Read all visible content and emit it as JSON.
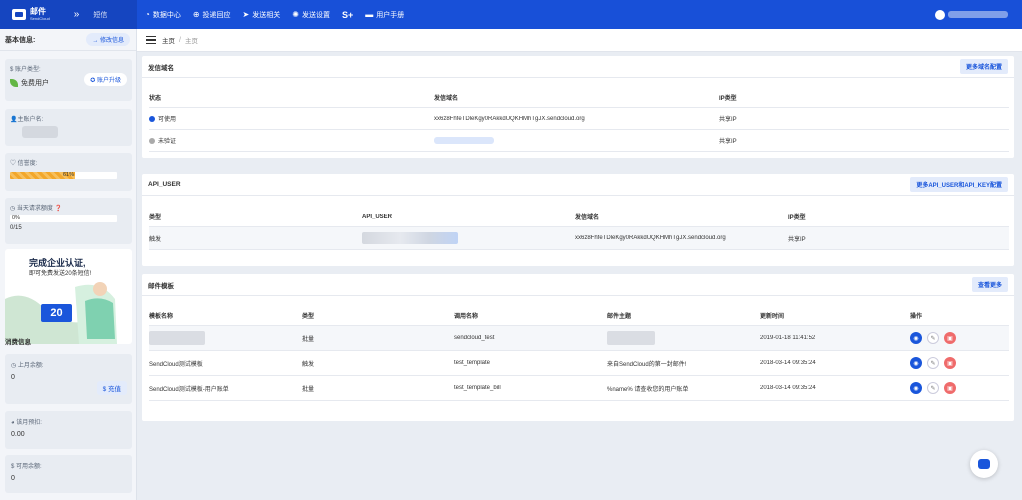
{
  "topbar": {
    "brand_name": "邮件",
    "brand_sub": "SendCloud",
    "collapse_glyph": "»",
    "sms_label": "短信",
    "nav": [
      {
        "icon": "chart-icon",
        "label": "数据中心"
      },
      {
        "icon": "delivery-icon",
        "label": "投递回应"
      },
      {
        "icon": "send-icon",
        "label": "发送相关"
      },
      {
        "icon": "settings-icon",
        "label": "发送设置"
      },
      {
        "icon": "s-plus-icon",
        "label": "S+"
      },
      {
        "icon": "folder-icon",
        "label": "用户手册"
      }
    ]
  },
  "sidebar": {
    "title": "基本信息:",
    "edit_btn": "→ 修改信息",
    "account_type_label": "$ 账户类型:",
    "account_type_value": "免费用户",
    "upgrade_btn": "✪ 账户升级",
    "account_name_label": "主账户名:",
    "credit_label": "信誉度:",
    "credit_value": "61%",
    "credit_fraction": 0.61,
    "daily_label": "当天请求额度",
    "daily_percent": "0%",
    "daily_count": "0/15",
    "promo_title": "完成企业认证,",
    "promo_sub": "即可免费发送20条短信!",
    "promo_number": "20",
    "consume_title": "消费信息",
    "last_month_label": "上月余额:",
    "last_month_value": "0",
    "recharge_btn": "$ 充值",
    "month_estimate_label": "该月预扣:",
    "month_estimate_value": "0.00",
    "available_label": "可用余额:",
    "available_value": "0"
  },
  "breadcrumb": {
    "home": "主页",
    "sep": "/",
    "current": "主页"
  },
  "domains": {
    "title": "发信域名",
    "button": "更多域名配置",
    "headers": [
      "状态",
      "发信域名",
      "IP类型"
    ],
    "rows": [
      {
        "status": "可使用",
        "domain": "xx6z8FhfeTDleKgy0RAkkdUQKHMhTgJX.sendcloud.org",
        "ip": "共享IP"
      },
      {
        "status": "未验证",
        "domain": "",
        "ip": "共享IP"
      }
    ]
  },
  "api_user": {
    "title": "API_USER",
    "button": "更多API_USER和API_KEY配置",
    "headers": [
      "类型",
      "API_USER",
      "发信域名",
      "IP类型"
    ],
    "rows": [
      {
        "type": "触发",
        "api_user": "",
        "domain": "xx6z8FhfeTDleKgy0RAkkdUQKHMhTgJX.sendcloud.org",
        "ip": "共享IP"
      }
    ]
  },
  "templates": {
    "title": "邮件模板",
    "button": "查看更多",
    "headers": [
      "模板名称",
      "类型",
      "调用名称",
      "邮件主题",
      "更新时间",
      "操作"
    ],
    "rows": [
      {
        "name": "",
        "type": "批量",
        "call": "sendcloud_test",
        "subject": "",
        "time": "2019-01-18 11:41:52"
      },
      {
        "name": "SendCloud测试模板",
        "type": "触发",
        "call": "test_template",
        "subject": "来自SendCloud的第一封邮件!",
        "time": "2018-03-14 09:35:24"
      },
      {
        "name": "SendCloud测试模板-用户账单",
        "type": "批量",
        "call": "test_template_bill",
        "subject": "%name% 请查收您的用户账单",
        "time": "2018-03-14 09:35:24"
      }
    ]
  },
  "colors": {
    "primary": "#1850d8",
    "accent": "#1a56db",
    "danger": "#ef6b6b",
    "progress": "#f2a72b"
  }
}
